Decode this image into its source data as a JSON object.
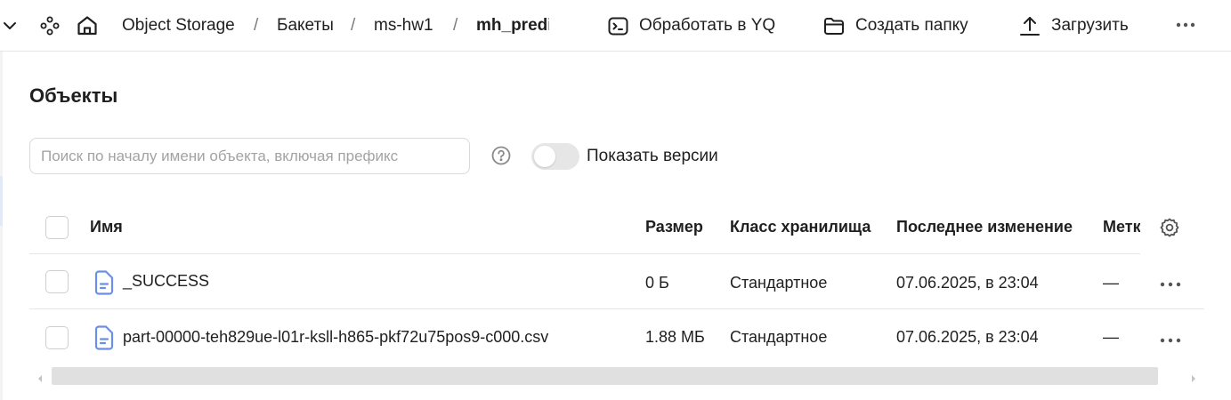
{
  "header": {
    "breadcrumbs": [
      "Object Storage",
      "Бакеты",
      "ms-hw1",
      "mh_predi"
    ],
    "separator": "/",
    "actions": {
      "process_yq": "Обработать в YQ",
      "create_folder": "Создать папку",
      "upload": "Загрузить"
    },
    "icons": [
      "chevron-down-icon",
      "services-icon",
      "home-icon",
      "terminal-icon",
      "folder-icon",
      "upload-icon",
      "more-icon"
    ]
  },
  "page": {
    "title": "Объекты"
  },
  "search": {
    "placeholder": "Поиск по началу имени объекта, включая префикс",
    "value": ""
  },
  "versions_toggle": {
    "label": "Показать версии",
    "checked": false
  },
  "table": {
    "columns": {
      "name": "Имя",
      "size": "Размер",
      "storage_class": "Класс хранилища",
      "modified": "Последнее изменение",
      "labels": "Метки"
    },
    "rows": [
      {
        "name": "_SUCCESS",
        "size": "0 Б",
        "storage_class": "Стандартное",
        "modified": "07.06.2025, в 23:04",
        "labels": "—"
      },
      {
        "name": "part-00000-teh829ue-l01r-ksll-h865-pkf72u75pos9-c000.csv",
        "size": "1.88 МБ",
        "storage_class": "Стандартное",
        "modified": "07.06.2025, в 23:04",
        "labels": "—"
      }
    ]
  },
  "colors": {
    "accent_file_icon": "#6b8fe6",
    "border": "#e5e5e5",
    "text": "#1f1f1f"
  }
}
